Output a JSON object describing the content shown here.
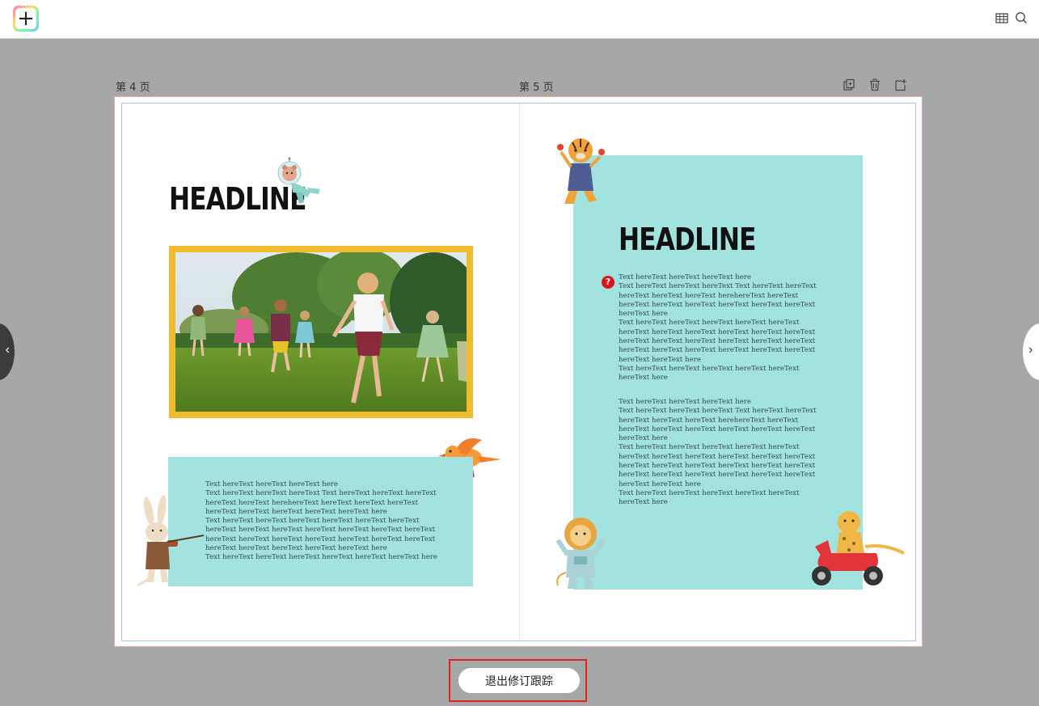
{
  "toolbar": {
    "logo_glyph": "+",
    "icons": [
      "grid-table-icon",
      "search-icon"
    ]
  },
  "pages": {
    "left_label": "第 4 页",
    "right_label": "第 5 页",
    "tools": [
      "duplicate-page-icon",
      "delete-page-icon",
      "add-page-icon"
    ]
  },
  "left_page": {
    "headline": "HEADLINE",
    "body_text": "Text hereText hereText hereText here\nText hereText hereText hereText Text hereText hereText hereText\nhereText hereText herehereText hereText hereText hereText\nhereText hereText hereText hereText hereText here\nText hereText hereText hereText hereText hereText hereText\nhereText hereText hereText hereText hereText hereText hereText\nhereText hereText hereText hereText hereText hereText hereText\nhereText hereText hereText hereText hereText here\nText hereText hereText hereText hereText hereText hereText here"
  },
  "right_page": {
    "headline": "HEADLINE",
    "badge": "?",
    "body_text_1": "Text hereText hereText hereText here\nText hereText hereText hereText Text hereText hereText\nhereText hereText hereText herehereText hereText\nhereText hereText hereText hereText hereText hereText\nhereText here\nText hereText hereText hereText hereText hereText\nhereText hereText hereText hereText hereText hereText\nhereText hereText hereText hereText hereText hereText\nhereText hereText hereText hereText hereText hereText\nhereText hereText here\nText hereText hereText hereText hereText hereText\nhereText here",
    "body_text_2": "Text hereText hereText hereText here\nText hereText hereText hereText Text hereText hereText\nhereText hereText hereText herehereText hereText\nhereText hereText hereText hereText hereText hereText\nhereText here\nText hereText hereText hereText hereText hereText\nhereText hereText hereText hereText hereText hereText\nhereText hereText hereText hereText hereText hereText\nhereText hereText hereText hereText hereText hereText\nhereText hereText here\nText hereText hereText hereText hereText hereText\nhereText here"
  },
  "navigation": {
    "prev_glyph": "‹",
    "next_glyph": "›"
  },
  "exit_button_label": "退出修订跟踪",
  "colors": {
    "background": "#a6a7a9",
    "textbox": "#a2e3e0",
    "photo_frame": "#f2bb2e",
    "highlight": "#e2231a"
  }
}
